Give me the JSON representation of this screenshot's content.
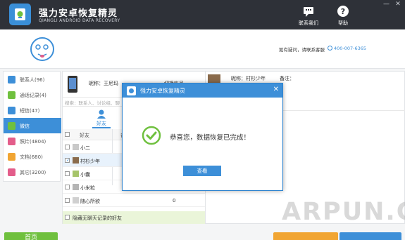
{
  "app": {
    "title": "强力安卓恢复精灵",
    "subtitle": "QIANGLI ANDROID DATA RECOVERY"
  },
  "header_buttons": [
    {
      "label": "联系我们",
      "icon": "chat-icon"
    },
    {
      "label": "帮助",
      "icon": "help-icon"
    }
  ],
  "window_controls": [
    "—",
    "✕"
  ],
  "support": {
    "label": "如有疑问，请联系客服",
    "phone": "400-007-6365"
  },
  "sidebar": {
    "items": [
      {
        "label": "联系人(96)",
        "icon": "contacts-icon",
        "color": "#3d8fd8",
        "active": false
      },
      {
        "label": "通话记录(4)",
        "icon": "phone-icon",
        "color": "#6fc03e",
        "active": false
      },
      {
        "label": "短信(47)",
        "icon": "sms-icon",
        "color": "#3d8fd8",
        "active": false
      },
      {
        "label": "微信",
        "icon": "wechat-icon",
        "color": "#6fc03e",
        "active": true
      },
      {
        "label": "照片(4804)",
        "icon": "photo-icon",
        "color": "#e35d8a",
        "active": false
      },
      {
        "label": "文档(680)",
        "icon": "document-icon",
        "color": "#f1a533",
        "active": false
      },
      {
        "label": "其它(3200)",
        "icon": "other-icon",
        "color": "#e35d8a",
        "active": false
      }
    ]
  },
  "account": {
    "nickname": "昵称：王尼玛",
    "switch": "切换帐号"
  },
  "search": {
    "placeholder": "搜索：联系人、讨论组、聊"
  },
  "friend_tab": {
    "label": "好友"
  },
  "table": {
    "header": "好友",
    "header_short": "备",
    "rows": [
      {
        "name": "小二",
        "count": "",
        "checked": false,
        "selected": false
      },
      {
        "name": "村杉少年",
        "count": "",
        "checked": true,
        "selected": true
      },
      {
        "name": "小囊",
        "count": "",
        "checked": false,
        "selected": false
      },
      {
        "name": "小米粒",
        "count": "",
        "checked": false,
        "selected": false
      },
      {
        "name": "随心所欲",
        "count": "0",
        "checked": false,
        "selected": false
      }
    ],
    "hide_label": "隐藏无聊天记录的好友"
  },
  "detail": {
    "nickname": "昵称：村杉少年",
    "remark": "备注："
  },
  "bottom": {
    "next_label": "首页"
  },
  "watermark": "ARPUN.COM",
  "dialog": {
    "title": "强力安卓恢复精灵",
    "close": "✕",
    "message": "恭喜您，数据恢复已完成！",
    "button": "查看"
  },
  "colors": {
    "accent": "#3d8fd8",
    "success": "#6fc03e",
    "topbar": "#2e3138"
  }
}
